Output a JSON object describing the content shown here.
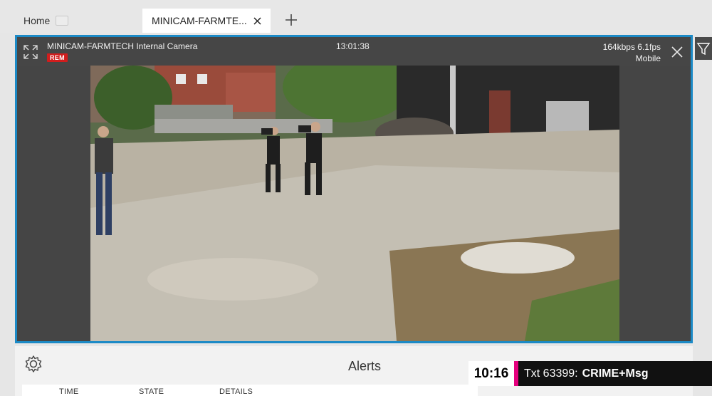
{
  "tabs": {
    "home_label": "Home",
    "active_label": "MINICAM-FARMTE..."
  },
  "camera": {
    "title": "MINICAM-FARMTECH Internal Camera",
    "rec_badge": "REM",
    "time": "13:01:38",
    "bitrate": "164kbps",
    "fps": "6.1fps",
    "mode": "Mobile"
  },
  "alerts": {
    "title": "Alerts",
    "columns": [
      "TIME",
      "STATE",
      "DETAILS"
    ]
  },
  "ticker": {
    "time": "10:16",
    "prefix": "Txt 63399:",
    "message": "CRIME+Msg"
  },
  "colors": {
    "frame_accent": "#1c8ac6",
    "rec_red": "#d11d1d",
    "ticker_magenta": "#e6007e"
  },
  "icons": {
    "expand": "expand-icon",
    "close": "close-icon",
    "new_tab": "plus-icon",
    "settings": "gear-icon",
    "filter": "filter-icon"
  }
}
